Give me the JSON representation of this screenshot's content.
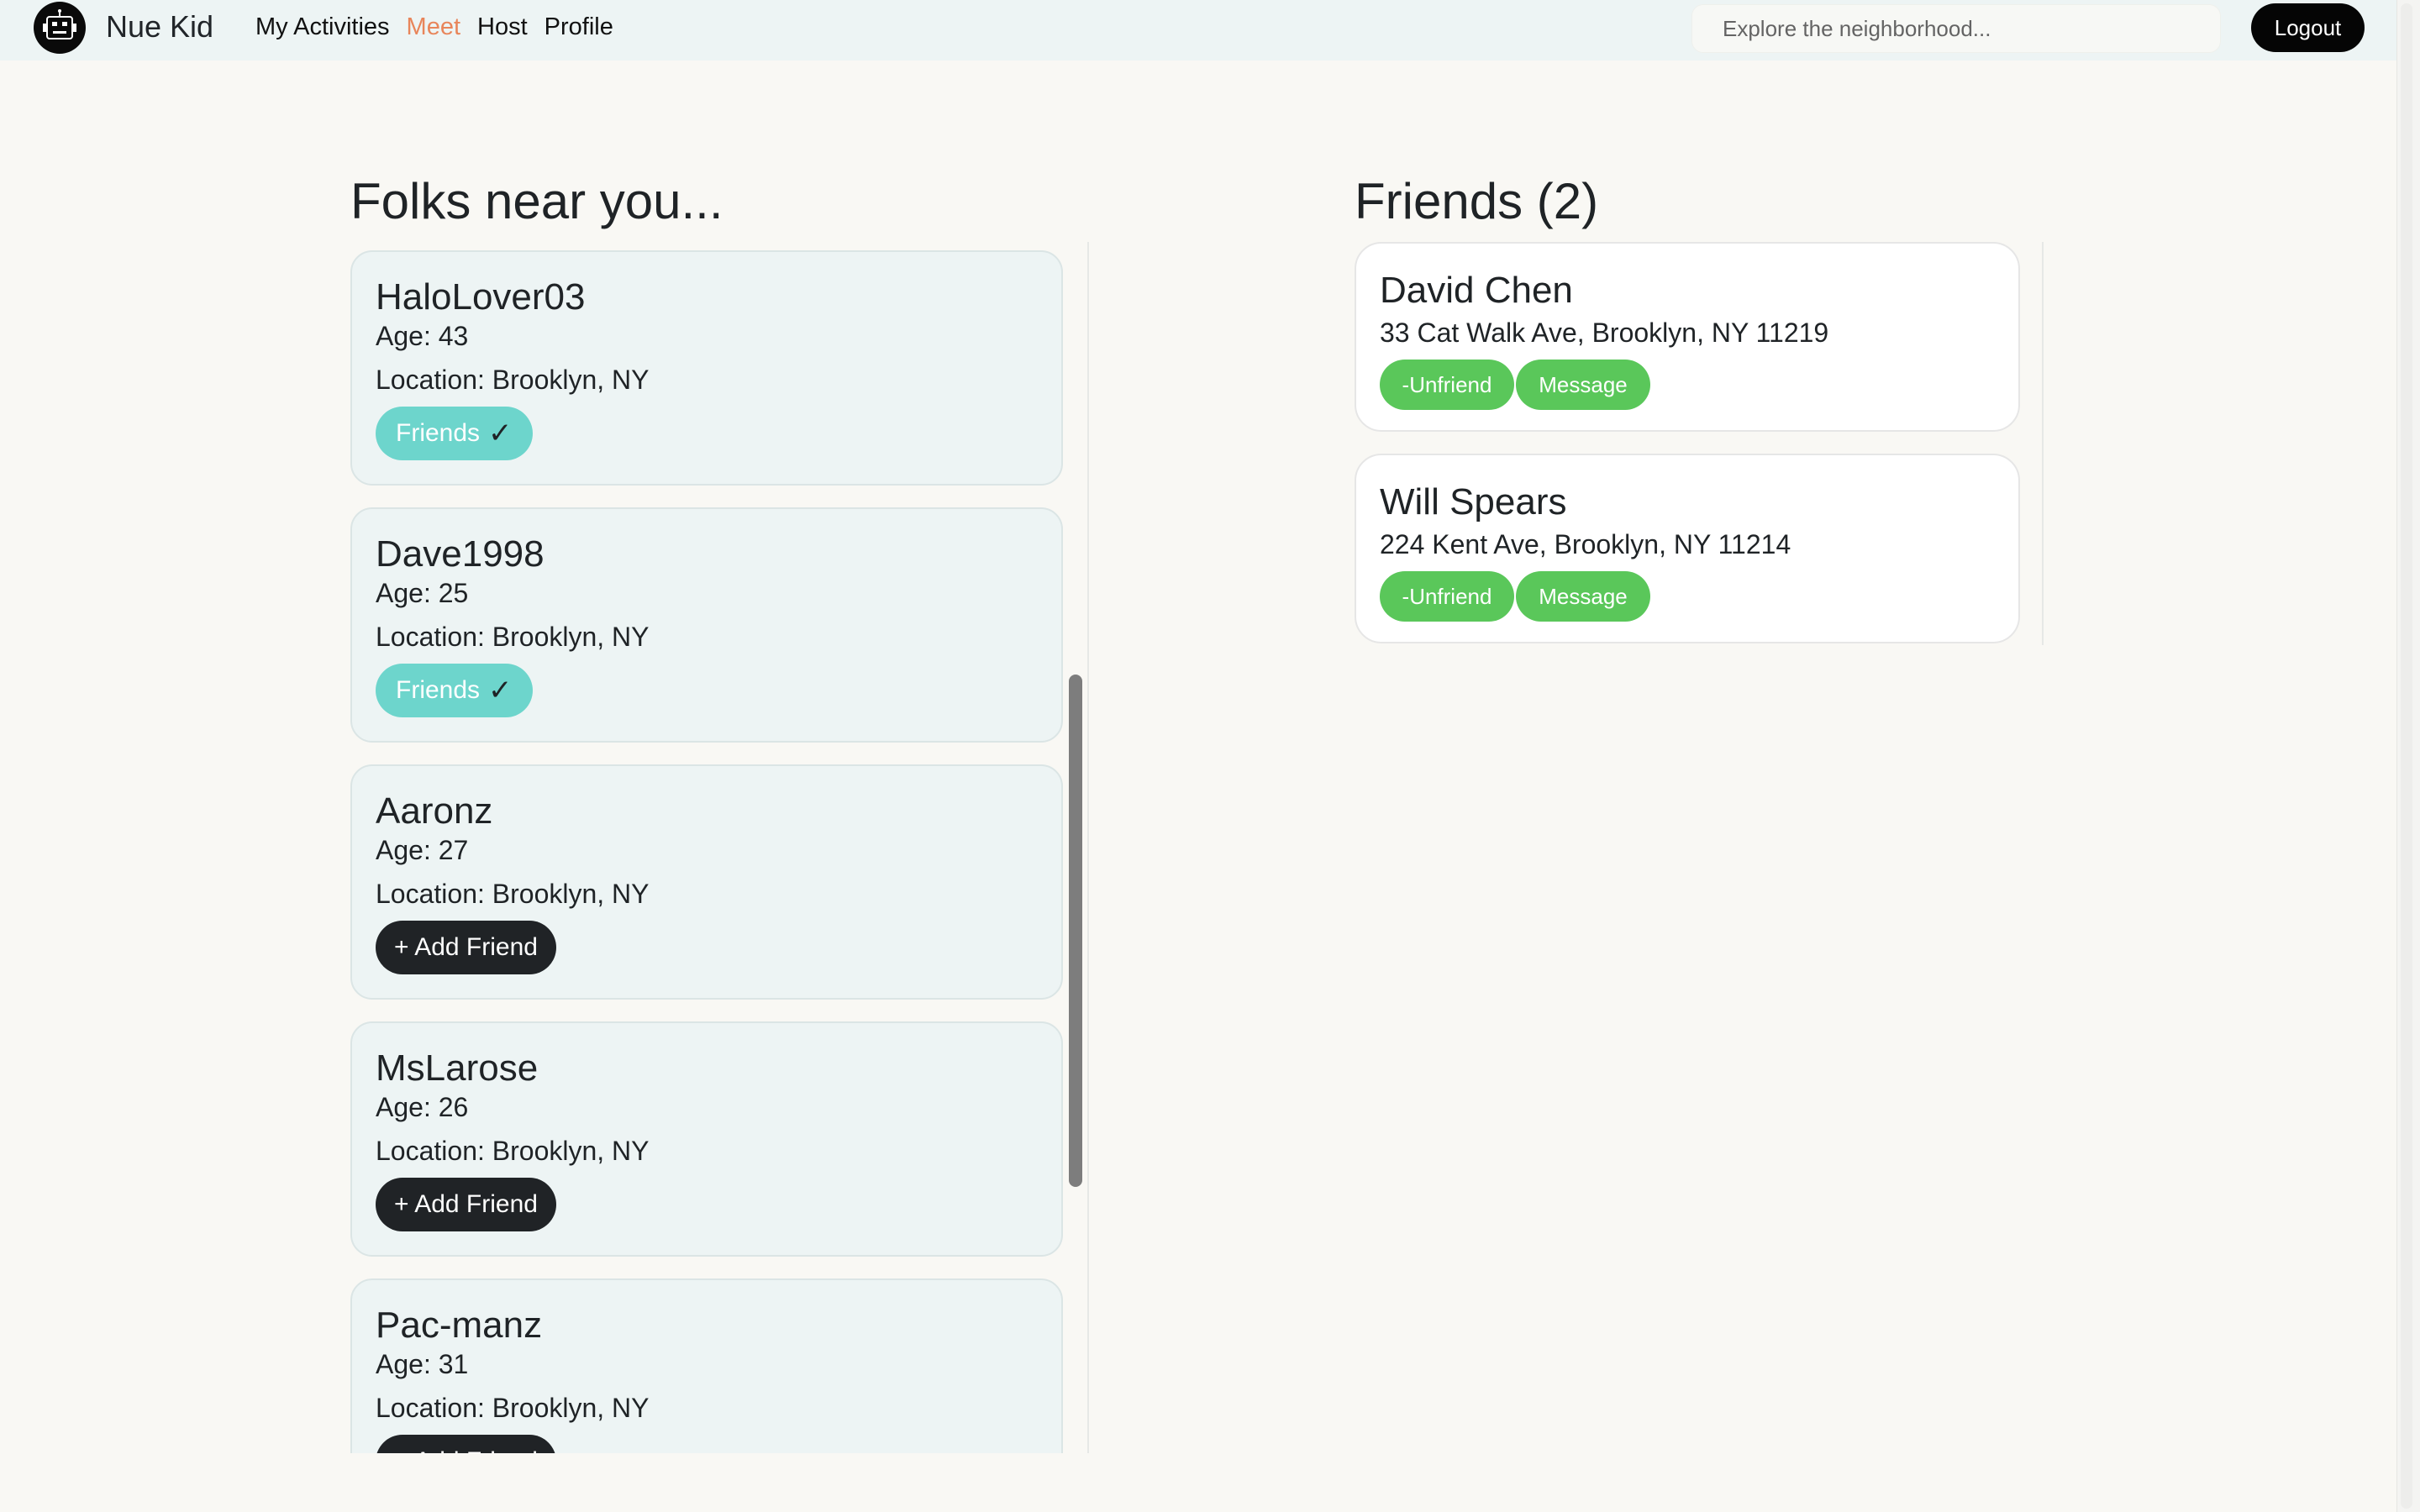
{
  "brand": {
    "name": "Nue Kid",
    "logo_icon": "robot-icon"
  },
  "nav": {
    "links": [
      {
        "label": "My Activities",
        "active": false
      },
      {
        "label": "Meet",
        "active": true
      },
      {
        "label": "Host",
        "active": false
      },
      {
        "label": "Profile",
        "active": false
      }
    ],
    "active_color": "#e8855a"
  },
  "search": {
    "placeholder": "Explore the neighborhood...",
    "value": ""
  },
  "logout_label": "Logout",
  "folks": {
    "title": "Folks near you...",
    "items": [
      {
        "name": "",
        "age": "",
        "location": "",
        "status": "partial"
      },
      {
        "name": "HaloLover03",
        "age": "Age: 43",
        "location": "Location: Brooklyn, NY",
        "status": "friends",
        "action_label": "Friends",
        "action_icon": "✓"
      },
      {
        "name": "Dave1998",
        "age": "Age: 25",
        "location": "Location: Brooklyn, NY",
        "status": "friends",
        "action_label": "Friends",
        "action_icon": "✓"
      },
      {
        "name": "Aaronz",
        "age": "Age: 27",
        "location": "Location: Brooklyn, NY",
        "status": "add",
        "action_label": "+ Add Friend"
      },
      {
        "name": "MsLarose",
        "age": "Age: 26",
        "location": "Location: Brooklyn, NY",
        "status": "add",
        "action_label": "+ Add Friend"
      },
      {
        "name": "Pac-manz",
        "age": "Age: 31",
        "location": "Location: Brooklyn, NY",
        "status": "add",
        "action_label": "+ Add Friend"
      }
    ]
  },
  "friends": {
    "title": "Friends (2)",
    "items": [
      {
        "name": "David Chen",
        "address": "33 Cat Walk Ave, Brooklyn, NY 11219",
        "unfriend_label": "-Unfriend",
        "message_label": "Message"
      },
      {
        "name": "Will Spears",
        "address": "224 Kent Ave, Brooklyn, NY 11214",
        "unfriend_label": "-Unfriend",
        "message_label": "Message"
      }
    ]
  },
  "colors": {
    "navbar_bg": "#edf4f4",
    "page_bg": "#f9f8f4",
    "friends_pill": "#6dd5cc",
    "add_pill": "#202326",
    "green_button": "#5ac75a"
  }
}
